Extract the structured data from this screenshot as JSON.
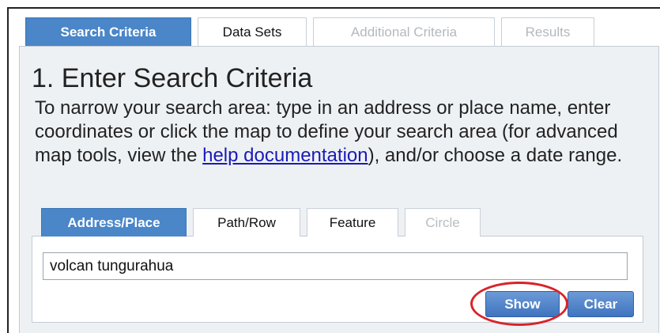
{
  "top_tabs": [
    {
      "label": "Search Criteria",
      "state": "active"
    },
    {
      "label": "Data Sets",
      "state": "normal"
    },
    {
      "label": "Additional Criteria",
      "state": "disabled"
    },
    {
      "label": "Results",
      "state": "disabled"
    }
  ],
  "section": {
    "title": "1. Enter Search Criteria",
    "description_before_link": "To narrow your search area: type in an address or place name, enter coordinates or click the map to define your search area (for advanced map tools, view the ",
    "help_link": "help documentation",
    "description_after_link": "), and/or choose a date range."
  },
  "inner_tabs": [
    {
      "label": "Address/Place",
      "state": "active"
    },
    {
      "label": "Path/Row",
      "state": "normal"
    },
    {
      "label": "Feature",
      "state": "normal"
    },
    {
      "label": "Circle",
      "state": "disabled"
    }
  ],
  "search": {
    "value": "volcan tungurahua"
  },
  "buttons": {
    "show": "Show",
    "clear": "Clear"
  },
  "colors": {
    "accent": "#4a86c8",
    "highlight": "#d8232a",
    "link": "#1a1ab8"
  }
}
